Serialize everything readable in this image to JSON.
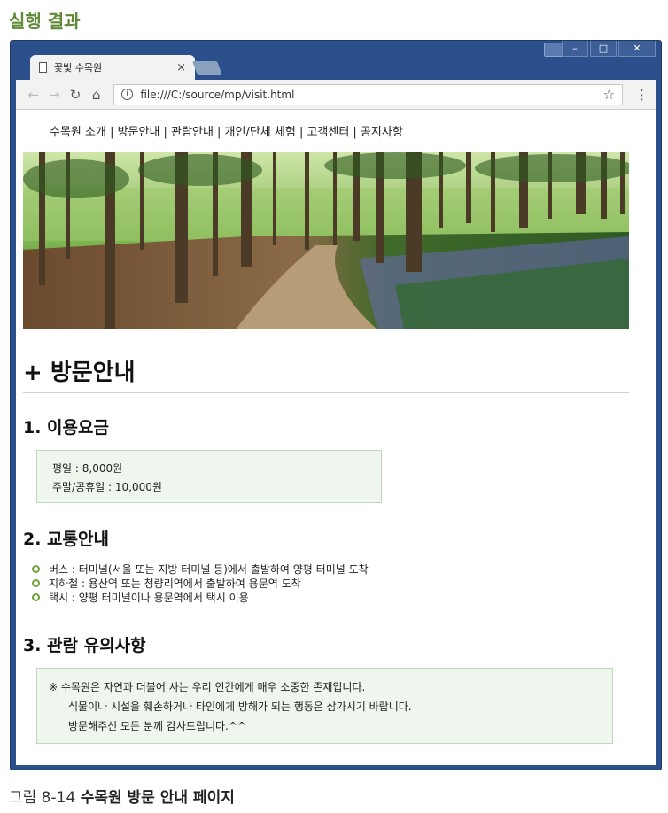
{
  "book": {
    "top_caption": "실행 결과",
    "figure_number": "그림 8-14",
    "figure_title": "수목원 방문 안내 페이지"
  },
  "browser": {
    "tab_title": "꽃빛 수목원",
    "tab_close": "×",
    "url": "file:///C:/source/mp/visit.html",
    "window_controls": {
      "minimize": "–",
      "maximize": "□",
      "close": "✕"
    },
    "icons": {
      "back": "←",
      "forward": "→",
      "reload": "↻",
      "home": "⌂",
      "star": "☆",
      "menu": "⋮",
      "info": "i"
    }
  },
  "site": {
    "nav": "수목원 소개 | 방문안내 | 관람안내 | 개인/단체 체험 | 고객센터 | 공지사항",
    "heading": "+ 방문안내",
    "sections": {
      "fee": {
        "title": "1. 이용요금",
        "lines": [
          "평일 : 8,000원",
          "주말/공휴일 : 10,000원"
        ]
      },
      "traffic": {
        "title": "2. 교통안내",
        "items": [
          "버스 : 터미널(서울 또는 지방 터미널 등)에서 출발하여 양평 터미널 도착",
          "지하철 : 용산역 또는 청량리역에서 출발하여 용문역 도착",
          "택시 : 양평 터미널이나 용문역에서 택시 이용"
        ]
      },
      "notice": {
        "title": "3. 관람 유의사항",
        "lines": [
          "※ 수목원은 자연과 더불어 사는 우리 인간에게 매우 소중한 존재입니다.",
          "식물이나 시설을 훼손하거나 타인에게 방해가 되는 행동은 삼가시기 바랍니다.",
          "방문해주신 모든 분께 감사드립니다.^^"
        ]
      }
    }
  },
  "colors": {
    "accent_green": "#6ea33a",
    "box_bg": "#eef6ee",
    "window_frame": "#2b4f8a"
  }
}
